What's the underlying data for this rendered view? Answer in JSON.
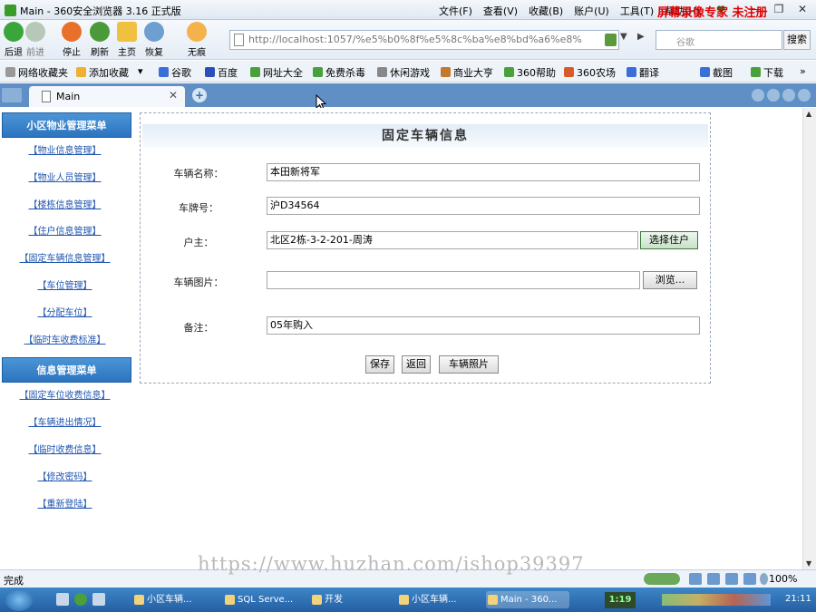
{
  "window": {
    "title": "Main - 360安全浏览器 3.16 正式版",
    "menu": [
      "文件(F)",
      "查看(V)",
      "收藏(B)",
      "账户(U)",
      "工具(T)",
      "帮助(H)"
    ]
  },
  "nav": {
    "back": "后退",
    "forward": "前进",
    "stop": "停止",
    "refresh": "刷新",
    "home": "主页",
    "restore": "恢复",
    "notrace": "无痕",
    "url": "http://localhost:1057/%e5%b0%8f%e5%8c%ba%e8%bd%a6%e8%",
    "search_placeholder": "谷歌",
    "search_button": "搜索"
  },
  "favorites": [
    "网络收藏夹",
    "添加收藏",
    "谷歌",
    "百度",
    "网址大全",
    "免费杀毒",
    "休闲游戏",
    "商业大亨",
    "360帮助",
    "360农场",
    "翻译",
    "截图",
    "下载"
  ],
  "tabs": [
    {
      "label": "Main"
    }
  ],
  "sidebar": {
    "section1_title": "小区物业管理菜单",
    "section1_items": [
      "【物业信息管理】",
      "【物业人员管理】",
      "【楼栋信息管理】",
      "【住户信息管理】",
      "【固定车辆信息管理】",
      "【车位管理】",
      "【分配车位】",
      "【临时车收费标准】"
    ],
    "section2_title": "信息管理菜单",
    "section2_items": [
      "【固定车位收费信息】",
      "【车辆进出情况】",
      "【临时收费信息】",
      "【修改密码】",
      "【重新登陆】"
    ]
  },
  "form": {
    "title": "固定车辆信息",
    "name_label": "车辆名称：",
    "name_value": "本田新将军",
    "plate_label": "车牌号：",
    "plate_value": "沪D34564",
    "owner_label": "户主：",
    "owner_value": "北区2栋-3-2-201-周涛",
    "select_owner_button": "选择住户",
    "image_label": "车辆图片：",
    "browse_button": "浏览...",
    "remark_label": "备注：",
    "remark_value": "05年购入",
    "save_button": "保存",
    "back_button": "返回",
    "photo_button": "车辆照片"
  },
  "status": {
    "text": "完成",
    "zoom": "100%"
  },
  "taskbar": {
    "tasks": [
      "小区车辆...",
      "SQL Serve...",
      "开发",
      "小区车辆...",
      "Main - 360..."
    ],
    "counter": "1:19",
    "time": "21:11"
  },
  "watermarks": {
    "top_right": "屏幕录像专家 未注册",
    "bottom_url": "https://www.huzhan.com/ishop39397"
  }
}
